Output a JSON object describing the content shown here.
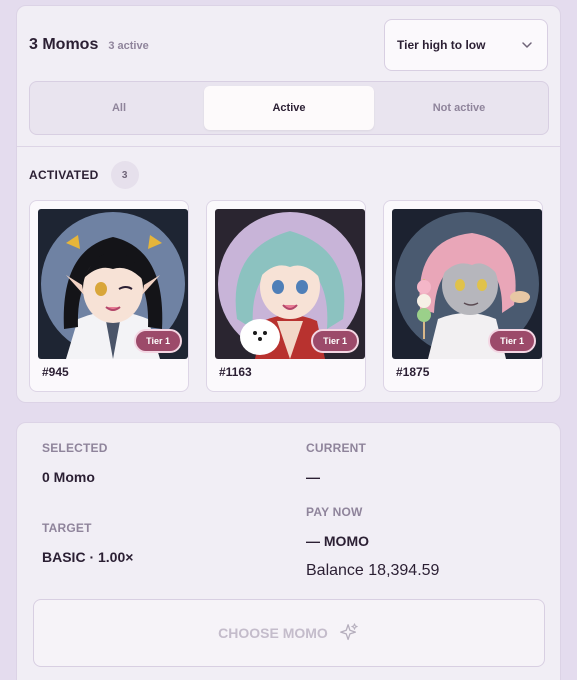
{
  "header": {
    "title": "3 Momos",
    "subtitle": "3 active",
    "sort_label": "Tier high to low"
  },
  "filter": {
    "options": [
      "All",
      "Active",
      "Not active"
    ],
    "selected": "Active"
  },
  "section": {
    "label": "ACTIVATED",
    "count": "3"
  },
  "cards": [
    {
      "id": "#945",
      "tier": "Tier 1"
    },
    {
      "id": "#1163",
      "tier": "Tier 1"
    },
    {
      "id": "#1875",
      "tier": "Tier 1"
    }
  ],
  "summary": {
    "selected_label": "SELECTED",
    "selected_value": "0 Momo",
    "current_label": "CURRENT",
    "current_value": "—",
    "target_label": "TARGET",
    "target_value": "BASIC · 1.00×",
    "pay_label": "PAY NOW",
    "pay_value": "— MOMO",
    "balance": "Balance 18,394.59"
  },
  "action": {
    "label": "CHOOSE MOMO",
    "icon": "sparkle-icon"
  },
  "colors": {
    "background": "#e4dcee",
    "panel": "#f1eef5",
    "badge": "#9c4a6a"
  }
}
